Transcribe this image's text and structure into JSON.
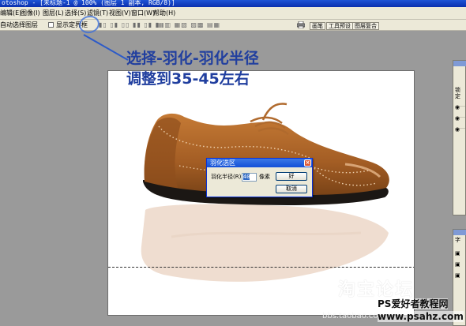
{
  "window": {
    "title": "otoshop - [未标题-1 @ 100% (图层 1 副本, RGB/8)]"
  },
  "menu": {
    "items": [
      "编辑(E)",
      "图像(I)",
      "图层(L)",
      "选择(S)",
      "滤镜(T)",
      "视图(V)",
      "窗口(W)",
      "帮助(H)"
    ]
  },
  "options": {
    "auto_select": "自动选择图层",
    "show_bounds": "显示定界框",
    "tab_brushes": "画笔",
    "tab_tool_presets": "工具预设",
    "tab_layer_comps": "图层复合"
  },
  "annotation": {
    "line1": "选择-羽化-羽化半径",
    "line2": "调整到35-45左右"
  },
  "dialog": {
    "title": "羽化选区",
    "radius_label": "羽化半径(R):",
    "radius_value": "40",
    "unit": "像素",
    "ok": "好",
    "cancel": "取消"
  },
  "panels": {
    "panel_a_label": "锁定",
    "panel_b_label": "字"
  },
  "watermarks": {
    "taobao": "淘宝论坛",
    "bbs": "bbs.taobao.com",
    "ps_name": "PS爱好者教程网",
    "ps_url": "www.psahz.com"
  },
  "colors": {
    "annotation_text": "#213f9f",
    "titlebar": "#0a2fae",
    "shoe_leather": "#b0692b"
  },
  "icons": [
    "print-icon",
    "close-icon",
    "eye-icon",
    "align-icons"
  ]
}
